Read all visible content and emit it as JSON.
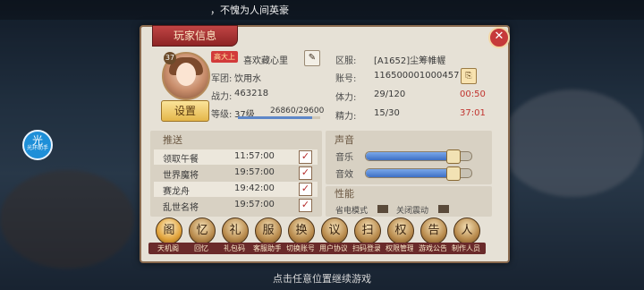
{
  "top_message": "，不愧为人间英豪",
  "bottom_hint": "点击任意位置继续游戏",
  "side_fab": {
    "label": "光",
    "sub": "光环助手"
  },
  "panel": {
    "title": "玩家信息",
    "close_icon": "close-icon",
    "player": {
      "level_badge": "37",
      "tag": "高大上",
      "name": "喜欢藏心里",
      "legion_label": "军团:",
      "legion_value": "饮用水",
      "power_label": "战力:",
      "power_value": "463218",
      "level_label": "等级:",
      "level_value": "37级",
      "exp_text": "26860/29600",
      "exp_fraction": 0.907,
      "settings_label": "设置"
    },
    "server_label": "区服:",
    "server_value": "[A1652]尘筹帷幄",
    "account_label": "账号:",
    "account_value": "116500001000457",
    "stamina_label": "体力:",
    "stamina_value": "29/120",
    "stamina_timer": "00:50",
    "energy_label": "精力:",
    "energy_value": "15/30",
    "energy_timer": "37:01"
  },
  "push": {
    "title": "推送",
    "rows": [
      {
        "name": "领取午餐",
        "time": "11:57:00",
        "checked": "✓"
      },
      {
        "name": "世界魔将",
        "time": "19:57:00",
        "checked": "✓"
      },
      {
        "name": "赛龙舟",
        "time": "19:42:00",
        "checked": "✓"
      },
      {
        "name": "乱世名将",
        "time": "19:57:00",
        "checked": "✓"
      }
    ]
  },
  "sound": {
    "title": "声音",
    "music_label": "音乐",
    "music_level": 0.82,
    "effect_label": "音效",
    "effect_level": 0.82
  },
  "performance": {
    "title": "性能",
    "power_save_label": "省电模式",
    "vibration_label": "关闭震动"
  },
  "actions": [
    {
      "label": "天机阁",
      "icon": "book-icon",
      "glyph": "阁"
    },
    {
      "label": "回忆",
      "icon": "leaf-icon",
      "glyph": "忆"
    },
    {
      "label": "礼包码",
      "icon": "gift-icon",
      "glyph": "礼"
    },
    {
      "label": "客服助手",
      "icon": "chat-icon",
      "glyph": "服"
    },
    {
      "label": "切换账号",
      "icon": "refresh-icon",
      "glyph": "换"
    },
    {
      "label": "用户协议",
      "icon": "document-icon",
      "glyph": "议"
    },
    {
      "label": "扫码登录",
      "icon": "scan-icon",
      "glyph": "扫"
    },
    {
      "label": "权限管理",
      "icon": "lock-icon",
      "glyph": "权"
    },
    {
      "label": "游戏公告",
      "icon": "notice-icon",
      "glyph": "告"
    },
    {
      "label": "制作人员",
      "icon": "people-icon",
      "glyph": "人"
    }
  ]
}
